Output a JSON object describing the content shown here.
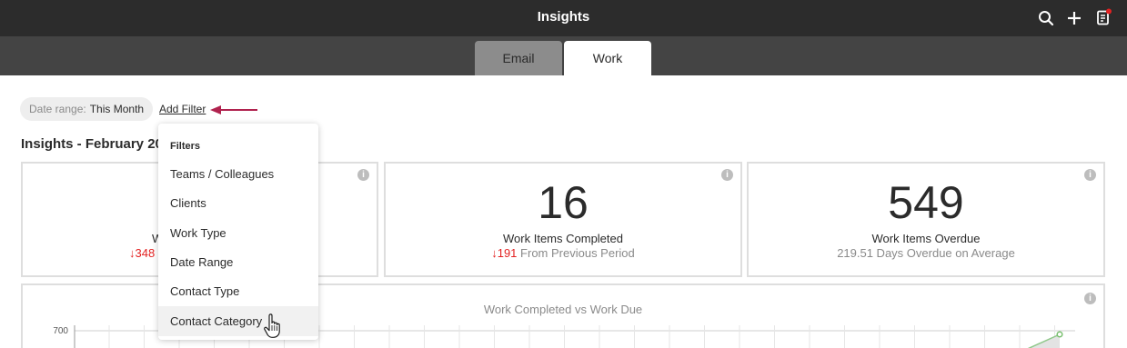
{
  "header": {
    "title": "Insights"
  },
  "top_icons": [
    "search-icon",
    "plus-icon",
    "notes-icon"
  ],
  "notification_dot_color": "#e32222",
  "tabs": [
    {
      "label": "Email",
      "active": false
    },
    {
      "label": "Work",
      "active": true
    }
  ],
  "filters_bar": {
    "date_range_label": "Date range:",
    "date_range_value": "This Month",
    "add_filter_label": "Add Filter"
  },
  "annotation_arrow_color": "#b0224e",
  "page_title": "Insights - February 20",
  "cards": [
    {
      "label_fragment": "W",
      "delta_fragment": "↓348"
    },
    {
      "value": "16",
      "label": "Work Items Completed",
      "delta": "↓191",
      "sub": "From Previous Period"
    },
    {
      "value": "549",
      "label": "Work Items Overdue",
      "sub": "219.51 Days Overdue on Average"
    }
  ],
  "info_icon_glyph": "i",
  "chart": {
    "title": "Work Completed vs Work Due",
    "y_tick": "700"
  },
  "chart_data": {
    "type": "line",
    "title": "Work Completed vs Work Due",
    "yticks": [
      700
    ]
  },
  "dropdown": {
    "header": "Filters",
    "items": [
      "Teams / Colleagues",
      "Clients",
      "Work Type",
      "Date Range",
      "Contact Type",
      "Contact Category"
    ],
    "hovered_item": "Contact Category"
  }
}
